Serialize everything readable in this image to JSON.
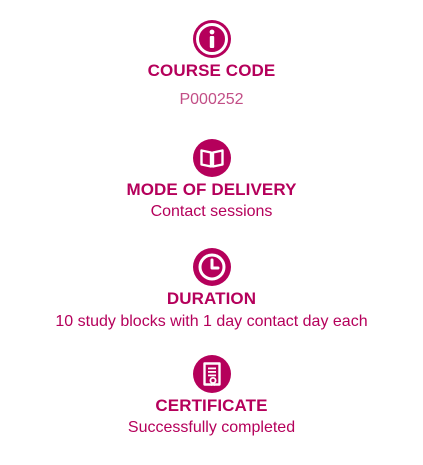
{
  "colors": {
    "accent": "#b5005b",
    "muted": "#c24e86"
  },
  "items": [
    {
      "icon": "info-circle-icon",
      "heading": "COURSE CODE",
      "value": "P000252"
    },
    {
      "icon": "open-book-icon",
      "heading": "MODE OF DELIVERY",
      "value": "Contact sessions"
    },
    {
      "icon": "clock-icon",
      "heading": "DURATION",
      "value": "10 study blocks with 1 day contact day each"
    },
    {
      "icon": "certificate-icon",
      "heading": "CERTIFICATE",
      "value": "Successfully completed"
    }
  ]
}
